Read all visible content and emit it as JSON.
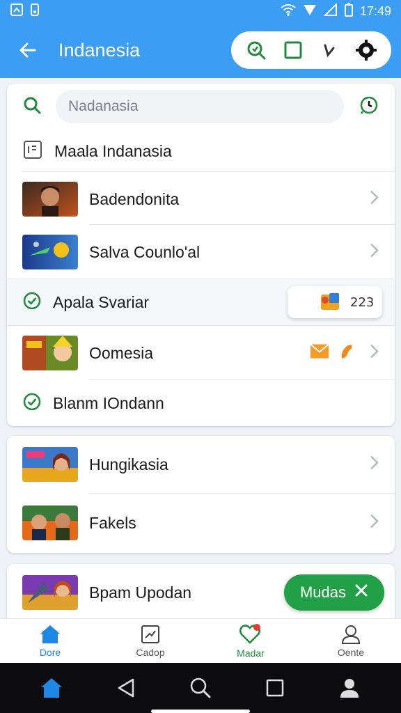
{
  "status_bar": {
    "time": "17:49"
  },
  "app_bar": {
    "title": "Indanesia"
  },
  "search": {
    "placeholder": "Nadanasia"
  },
  "list1": {
    "header_label": "Maala Indanasia",
    "items": [
      {
        "label": "Badendonita"
      },
      {
        "label": "Salva Counlo'al"
      },
      {
        "label": "Apala Svariar",
        "chip_text": "223"
      },
      {
        "label": "Oomesia"
      },
      {
        "label": "Blanm IOndann"
      }
    ]
  },
  "list2": {
    "items": [
      {
        "label": "Hungikasia"
      },
      {
        "label": "Fakels"
      }
    ]
  },
  "list3": {
    "items": [
      {
        "label": "Bpam Upodan"
      }
    ]
  },
  "fab": {
    "label": "Mudas"
  },
  "bottom_nav": {
    "items": [
      {
        "label": "Dore"
      },
      {
        "label": "Cadop"
      },
      {
        "label": "Madar"
      },
      {
        "label": "Oente"
      }
    ]
  },
  "colors": {
    "primary": "#3b9ef2",
    "accent_green": "#22a047",
    "nav_blue": "#1e88e5"
  }
}
